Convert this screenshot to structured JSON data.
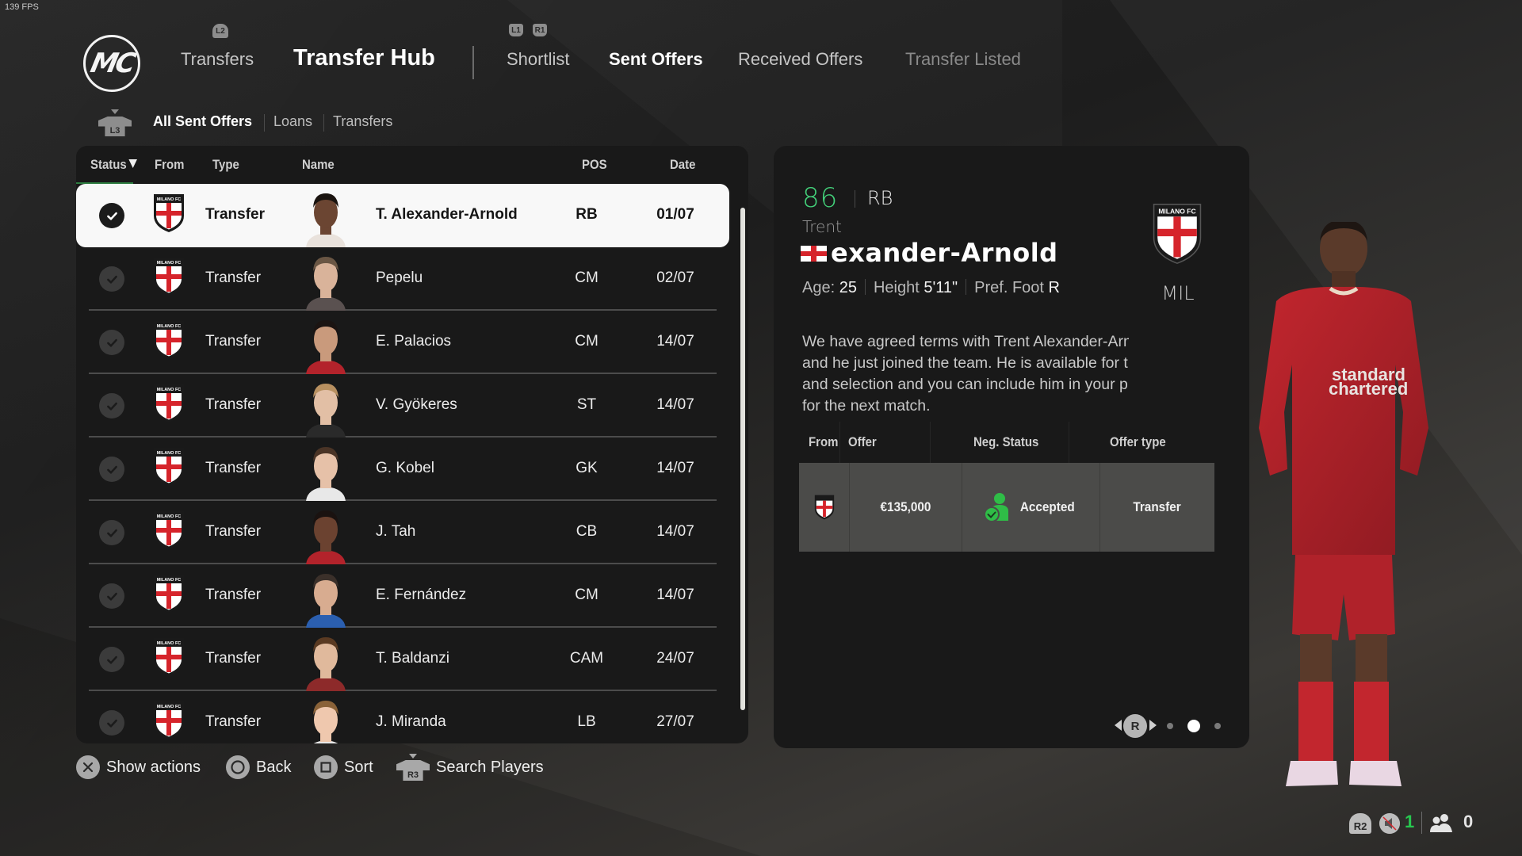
{
  "overlay": {
    "fps": "139 FPS"
  },
  "header": {
    "logo_text": "MC",
    "hints": {
      "prev_main": "L2",
      "prev_sub": "L1",
      "next_sub": "R1",
      "sub_filter": "L3"
    },
    "main_tabs": [
      {
        "label": "Transfers",
        "active": false
      },
      {
        "label": "Transfer Hub",
        "active": true
      }
    ],
    "sub_tabs": [
      {
        "label": "Shortlist",
        "active": false
      },
      {
        "label": "Sent Offers",
        "active": true
      },
      {
        "label": "Received Offers",
        "active": false
      },
      {
        "label": "Transfer Listed",
        "active": false,
        "disabled": true
      }
    ],
    "filters": [
      {
        "label": "All Sent Offers",
        "active": true
      },
      {
        "label": "Loans",
        "active": false
      },
      {
        "label": "Transfers",
        "active": false
      }
    ]
  },
  "list": {
    "columns": [
      "Status",
      "From",
      "Type",
      "Name",
      "POS",
      "Date"
    ],
    "sort_column": "Status",
    "rows": [
      {
        "status": "accepted",
        "from": "MILANO FC",
        "type": "Transfer",
        "name": "T. Alexander-Arnold",
        "pos": "RB",
        "date": "01/07",
        "selected": true
      },
      {
        "status": "accepted",
        "from": "MILANO FC",
        "type": "Transfer",
        "name": "Pepelu",
        "pos": "CM",
        "date": "02/07"
      },
      {
        "status": "accepted",
        "from": "MILANO FC",
        "type": "Transfer",
        "name": "E. Palacios",
        "pos": "CM",
        "date": "14/07"
      },
      {
        "status": "accepted",
        "from": "MILANO FC",
        "type": "Transfer",
        "name": "V. Gyökeres",
        "pos": "ST",
        "date": "14/07"
      },
      {
        "status": "accepted",
        "from": "MILANO FC",
        "type": "Transfer",
        "name": "G. Kobel",
        "pos": "GK",
        "date": "14/07"
      },
      {
        "status": "accepted",
        "from": "MILANO FC",
        "type": "Transfer",
        "name": "J. Tah",
        "pos": "CB",
        "date": "14/07"
      },
      {
        "status": "accepted",
        "from": "MILANO FC",
        "type": "Transfer",
        "name": "E. Fernández",
        "pos": "CM",
        "date": "14/07"
      },
      {
        "status": "accepted",
        "from": "MILANO FC",
        "type": "Transfer",
        "name": "T. Baldanzi",
        "pos": "CAM",
        "date": "24/07"
      },
      {
        "status": "accepted",
        "from": "MILANO FC",
        "type": "Transfer",
        "name": "J. Miranda",
        "pos": "LB",
        "date": "27/07"
      }
    ]
  },
  "detail": {
    "overall": "86",
    "position": "RB",
    "first_name": "Trent",
    "last_name": "exander-Arnold",
    "nationality": "England",
    "age_label": "Age:",
    "age": "25",
    "height_label": "Height",
    "height": "5'11\"",
    "foot_label": "Pref. Foot",
    "foot": "R",
    "club_crest_text": "MILANO FC",
    "club_abbr": "MIL",
    "message": "We have agreed terms with Trent Alexander-Arnold and he just joined the team. He is available for training and selection and you can include him in your plans for the next match.",
    "offer_table": {
      "headers": [
        "From",
        "Offer",
        "Neg. Status",
        "Offer type"
      ],
      "row": {
        "from": "MILANO FC",
        "offer": "€135,000",
        "neg_status": "Accepted",
        "offer_type": "Transfer"
      }
    },
    "pager": {
      "button": "R",
      "pages": 3,
      "current": 2
    }
  },
  "footer": {
    "actions": [
      {
        "button": "cross",
        "label": "Show actions"
      },
      {
        "button": "circle",
        "label": "Back"
      },
      {
        "button": "square",
        "label": "Sort"
      },
      {
        "button": "R3",
        "label": "Search Players"
      }
    ]
  },
  "system": {
    "r2_label": "R2",
    "mic_muted": true,
    "party_count_speaking": "1",
    "party_count": "0"
  },
  "colors": {
    "accent_green": "#43d17a",
    "crest_red": "#d6242b",
    "selected_row": "#f8f8f8",
    "panel_bg": "#191919"
  }
}
